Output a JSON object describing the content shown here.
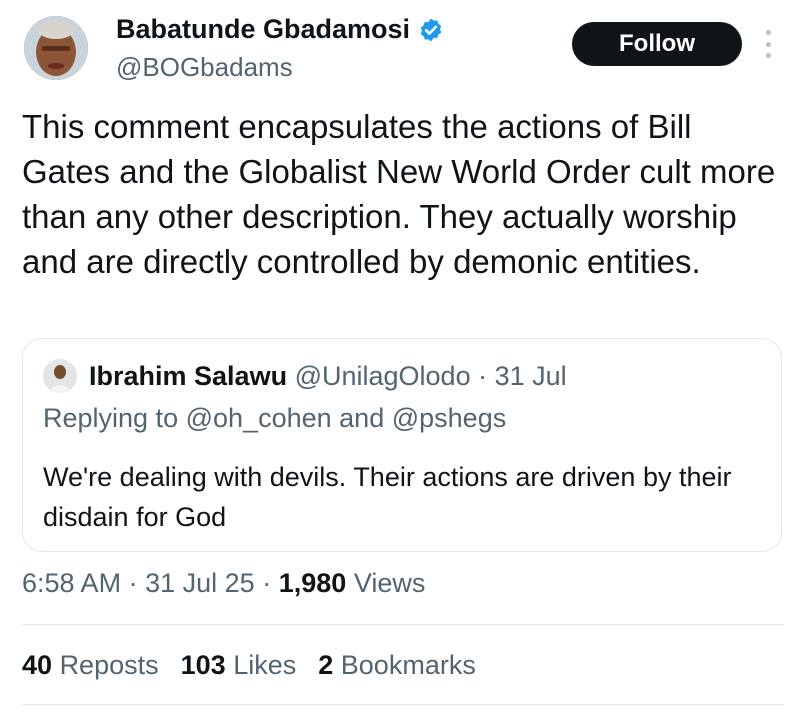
{
  "author": {
    "display_name": "Babatunde Gbadamosi",
    "handle": "@BOGbadams",
    "verified": true
  },
  "follow_label": "Follow",
  "tweet": {
    "text": "This comment encapsulates the actions of Bill Gates and the Globalist New World Order cult more than any other description. They actually worship and are directly controlled by demonic entities."
  },
  "quoted": {
    "display_name": "Ibrahim Salawu",
    "handle": "@UnilagOlodo",
    "separator": "·",
    "date": "31 Jul",
    "replying_prefix": "Replying to",
    "mention_1": "@oh_cohen",
    "and_word": "and",
    "mention_2": "@pshegs",
    "text": "We're dealing with devils. Their actions are driven by their disdain for God"
  },
  "meta": {
    "time": "6:58 AM",
    "sep": "·",
    "date": "31 Jul 25",
    "views_count": "1,980",
    "views_label": "Views"
  },
  "stats": {
    "reposts_count": "40",
    "reposts_label": "Reposts",
    "likes_count": "103",
    "likes_label": "Likes",
    "bookmarks_count": "2",
    "bookmarks_label": "Bookmarks"
  },
  "colors": {
    "text_primary": "#0f1419",
    "text_secondary": "#536471",
    "verified_blue": "#1d9bf0",
    "follow_bg": "#0f1419",
    "border": "#e2e6ea"
  },
  "icons": {
    "verified": "verified-badge-icon",
    "more": "more-vertical-icon"
  }
}
